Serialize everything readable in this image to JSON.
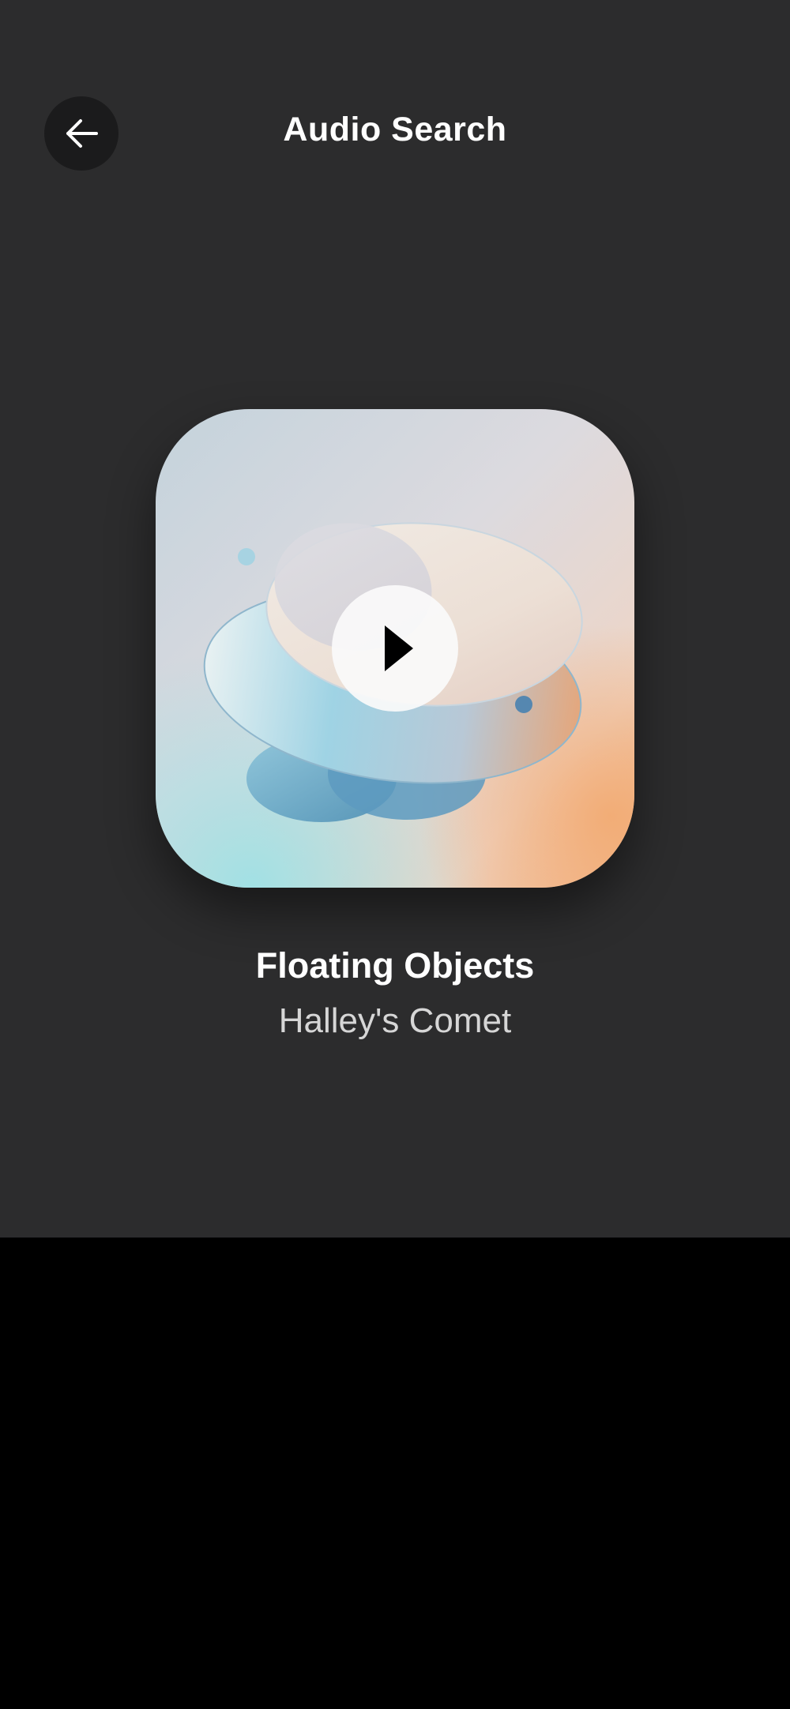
{
  "header": {
    "title": "Audio Search",
    "back_icon": "arrow-left-icon"
  },
  "player": {
    "play_icon": "play-icon",
    "track_title": "Floating Objects",
    "artist": "Halley's Comet"
  },
  "colors": {
    "background": "#2c2c2d",
    "back_button_bg": "#1b1b1c",
    "text_primary": "#ffffff",
    "text_secondary": "#d6d6d6",
    "bottom_area": "#000000"
  }
}
